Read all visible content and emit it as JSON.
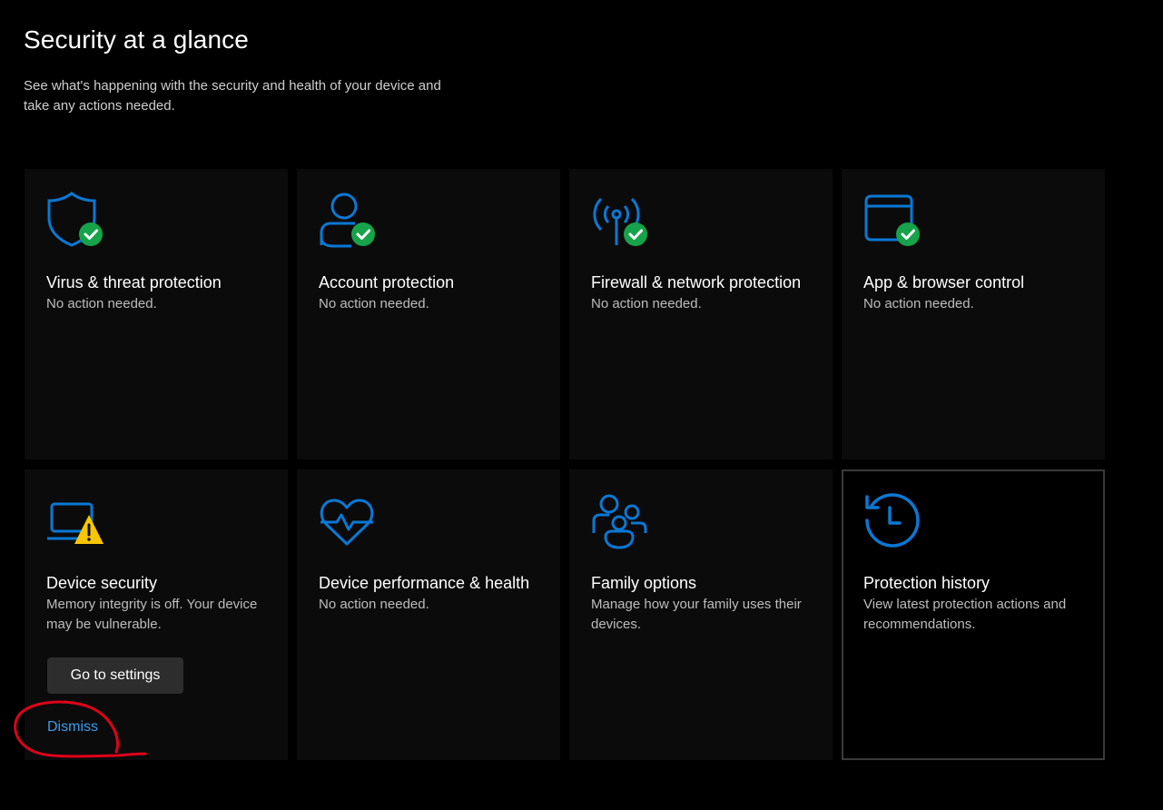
{
  "header": {
    "title": "Security at a glance",
    "subtitle": "See what's happening with the security and health of your device and take any actions needed."
  },
  "colors": {
    "accent": "#0a78d4",
    "ok_badge": "#16a34a",
    "warning": "#f7c600",
    "link": "#3b9ded",
    "annotation": "#e0001a"
  },
  "tiles": [
    {
      "title": "Virus & threat protection",
      "desc": "No action needed.",
      "icon": "shield-icon",
      "status": "ok"
    },
    {
      "title": "Account protection",
      "desc": "No action needed.",
      "icon": "person-icon",
      "status": "ok"
    },
    {
      "title": "Firewall & network protection",
      "desc": "No action needed.",
      "icon": "antenna-icon",
      "status": "ok"
    },
    {
      "title": "App & browser control",
      "desc": "No action needed.",
      "icon": "browser-window-icon",
      "status": "ok"
    },
    {
      "title": "Device security",
      "desc": "Memory integrity is off. Your device may be vulnerable.",
      "icon": "laptop-icon",
      "status": "warning",
      "button_label": "Go to settings",
      "link_label": "Dismiss"
    },
    {
      "title": "Device performance & health",
      "desc": "No action needed.",
      "icon": "heart-pulse-icon",
      "status": "none"
    },
    {
      "title": "Family options",
      "desc": "Manage how your family uses their devices.",
      "icon": "family-icon",
      "status": "none"
    },
    {
      "title": "Protection history",
      "desc": "View latest protection actions and recommendations.",
      "icon": "history-icon",
      "status": "none"
    }
  ]
}
